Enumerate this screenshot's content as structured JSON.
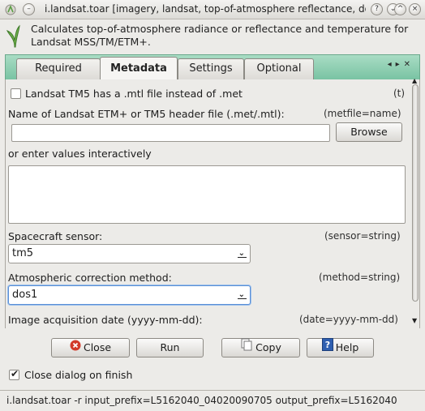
{
  "window": {
    "title": "i.landsat.toar [imagery, landsat, top-of-atmosphere reflectance, do...",
    "icon": "grass-icon",
    "controls": [
      "help-icon",
      "minimize-icon",
      "maximize-icon",
      "close-icon"
    ]
  },
  "header": {
    "description": "Calculates top-of-atmosphere radiance or reflectance and temperature for Landsat MSS/TM/ETM+."
  },
  "tabs": [
    {
      "label": "Required",
      "active": false
    },
    {
      "label": "Metadata",
      "active": true
    },
    {
      "label": "Settings",
      "active": false
    },
    {
      "label": "Optional",
      "active": false
    }
  ],
  "metadata": {
    "mtl_flag": {
      "label": "Landsat TM5 has a .mtl file instead of .met",
      "param": "(t)",
      "checked": false
    },
    "metfile": {
      "label": "Name of Landsat ETM+ or TM5 header file (.met/.mtl):",
      "param": "(metfile=name)",
      "value": "",
      "browse_label": "Browse"
    },
    "interactive": {
      "label": "or enter values interactively",
      "value": ""
    },
    "sensor": {
      "label": "Spacecraft sensor:",
      "param": "(sensor=string)",
      "value": "tm5"
    },
    "method": {
      "label": "Atmospheric correction method:",
      "param": "(method=string)",
      "value": "dos1"
    },
    "date": {
      "label": "Image acquisition date (yyyy-mm-dd):",
      "param": "(date=yyyy-mm-dd)"
    }
  },
  "buttons": {
    "close": "Close",
    "run": "Run",
    "copy": "Copy",
    "help": "Help"
  },
  "close_on_finish": {
    "label": "Close dialog on finish",
    "checked": true
  },
  "status": {
    "command": "i.landsat.toar -r input_prefix=L5162040_04020090705 output_prefix=L5162040"
  },
  "colors": {
    "tab_strip": "#8fd0b4",
    "focus": "#5a8fd6",
    "close_icon": "#d23a2a",
    "help_icon": "#2f5fb0"
  }
}
